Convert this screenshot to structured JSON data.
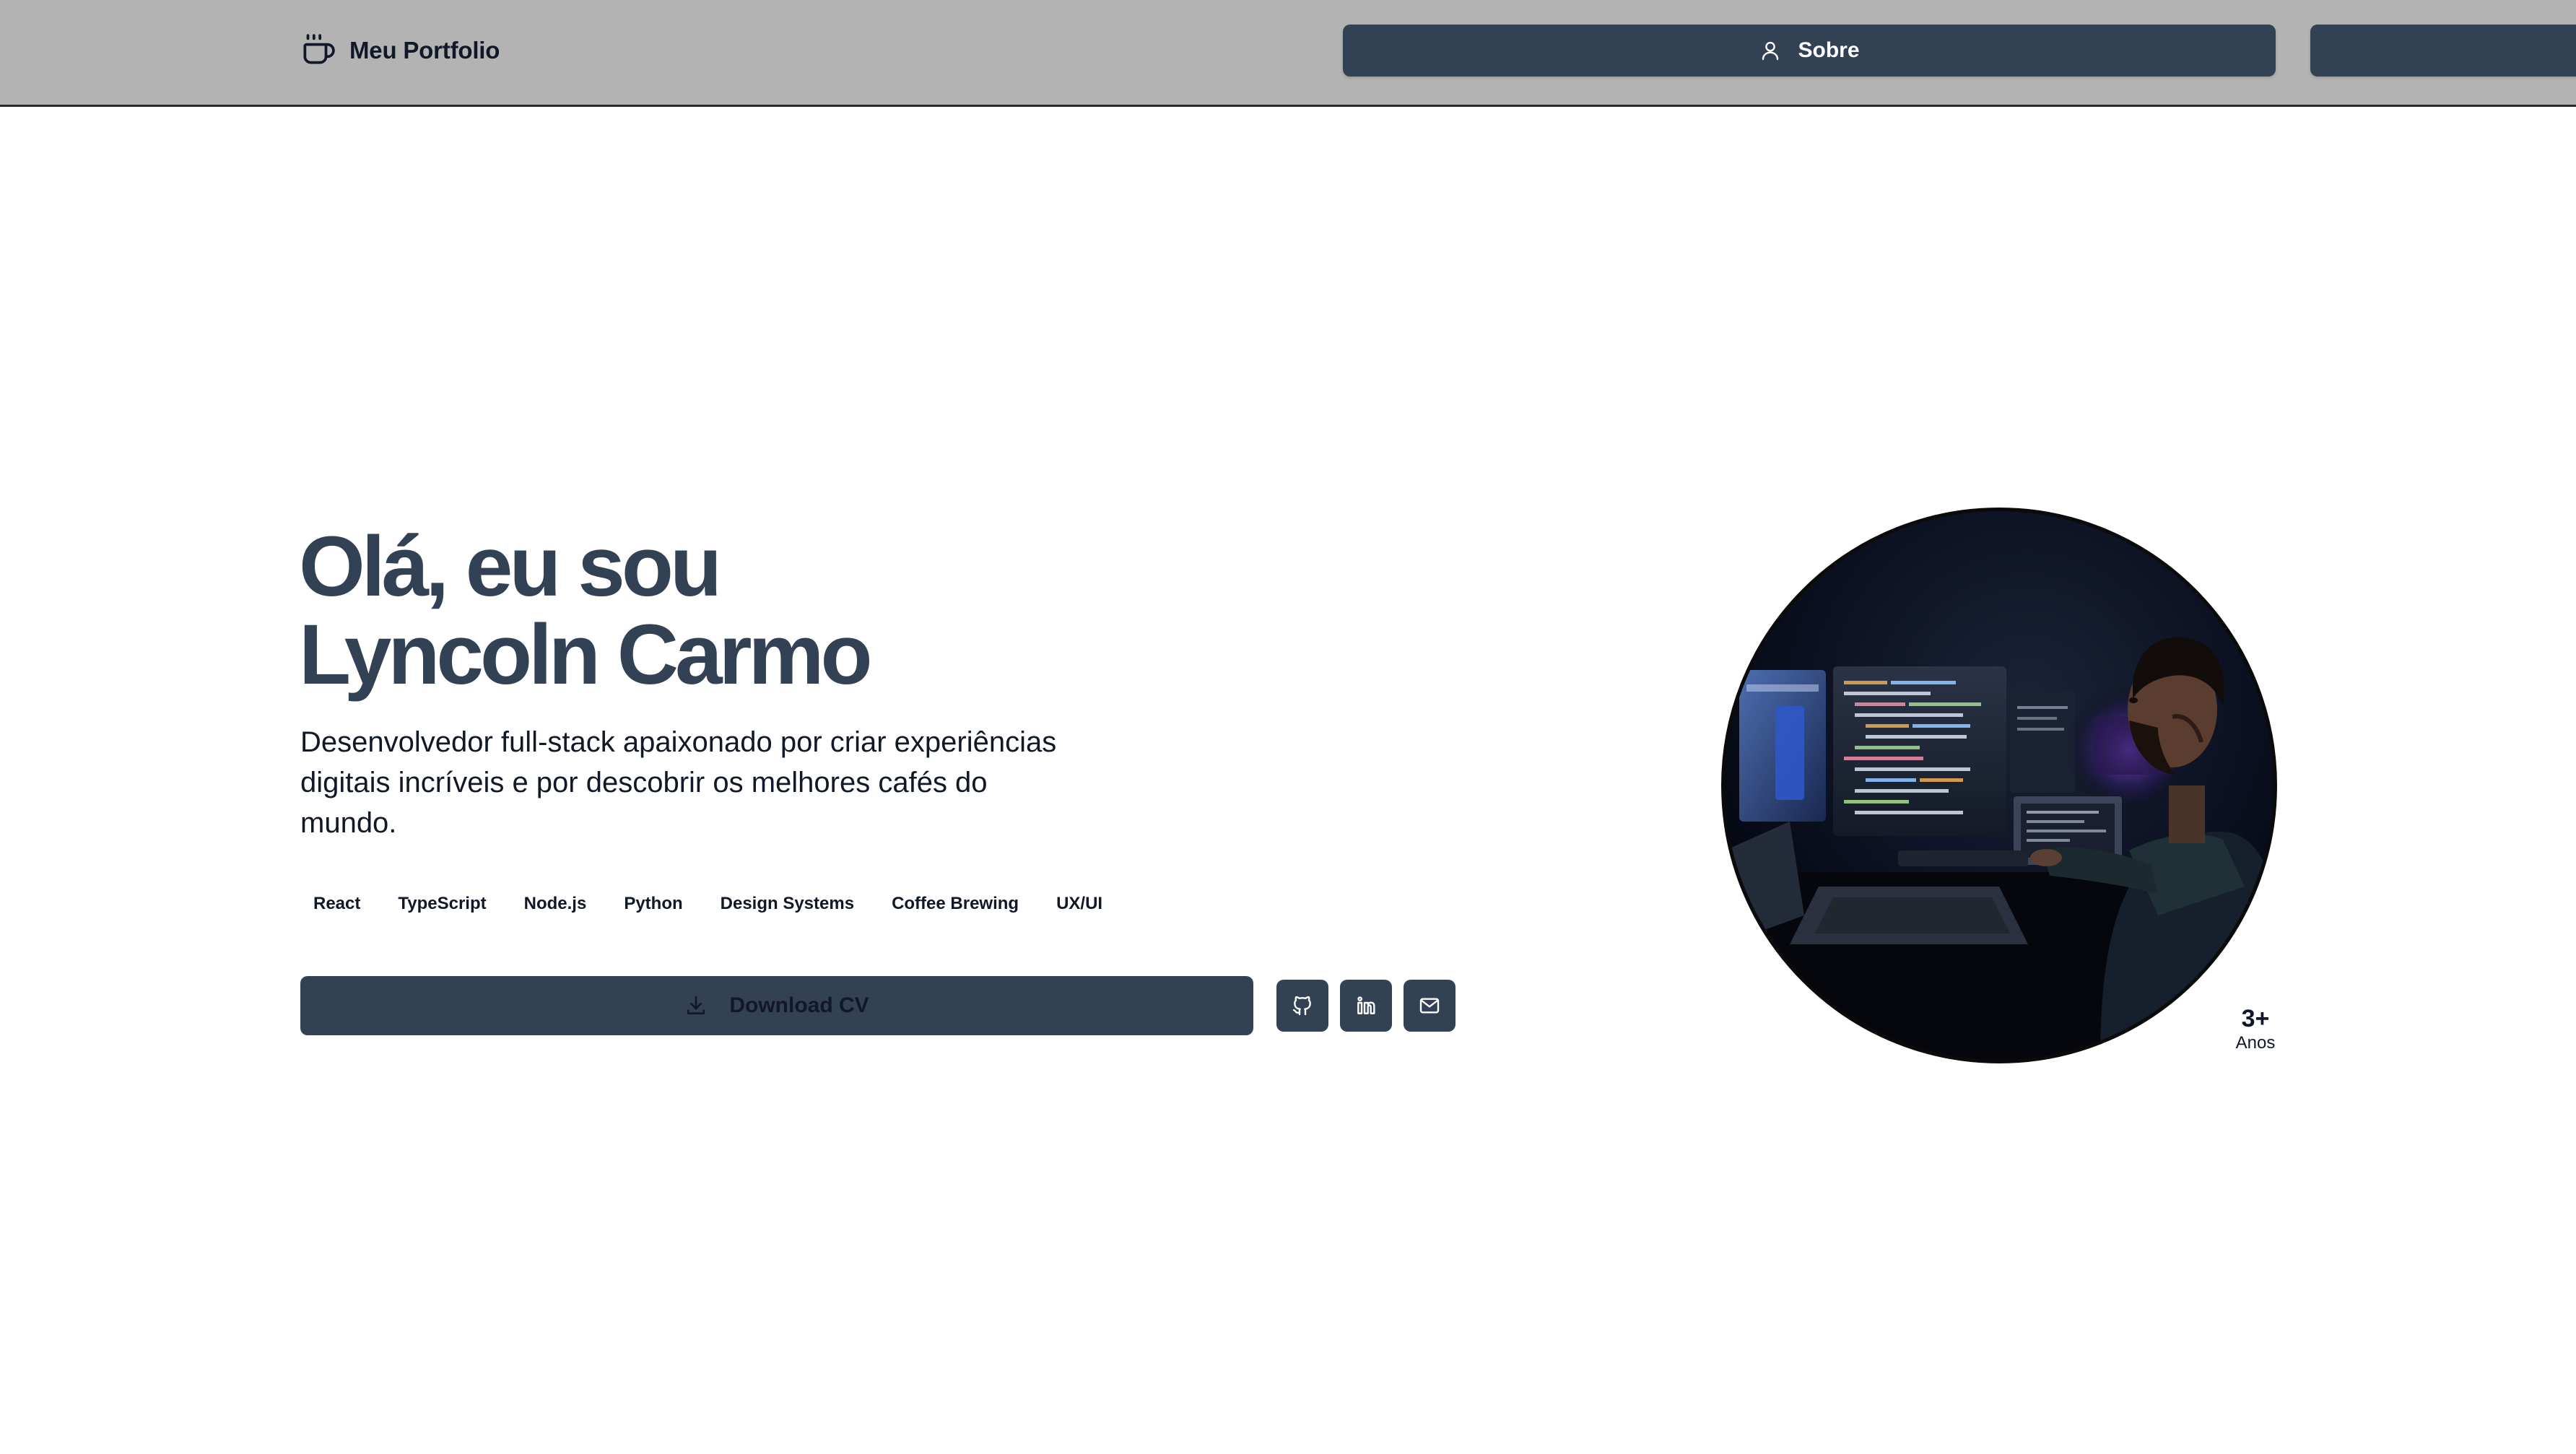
{
  "header": {
    "brand": "Meu Portfolio",
    "brand_icon": "coffee-cup-icon",
    "nav": [
      {
        "label": "Sobre",
        "icon": "user-icon"
      },
      {
        "label": "",
        "icon": ""
      }
    ]
  },
  "hero": {
    "title_line1": "Olá, eu sou",
    "title_line2": "Lyncoln Carmo",
    "description": "Desenvolvedor full-stack apaixonado por criar experiências digitais incríveis e por descobrir os melhores cafés do mundo.",
    "tags": [
      "React",
      "TypeScript",
      "Node.js",
      "Python",
      "Design Systems",
      "Coffee Brewing",
      "UX/UI"
    ],
    "download_label": "Download CV",
    "download_icon": "download-icon",
    "social": [
      {
        "name": "github",
        "icon": "github-icon"
      },
      {
        "name": "linkedin",
        "icon": "linkedin-icon"
      },
      {
        "name": "mail",
        "icon": "mail-icon"
      }
    ]
  },
  "profile": {
    "photo": "developer-at-computer-photo",
    "years_value": "3+",
    "years_label": "Anos"
  },
  "colors": {
    "header_bg": "#b3b3b3",
    "accent": "#334155",
    "title": "#334155",
    "text": "#111827",
    "background": "#ffffff"
  }
}
